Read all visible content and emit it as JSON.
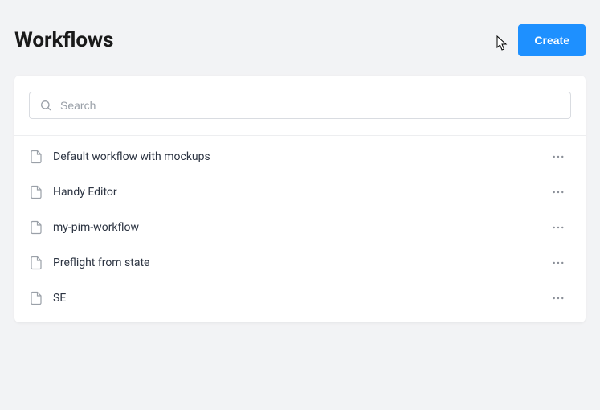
{
  "header": {
    "title": "Workflows",
    "create_label": "Create"
  },
  "search": {
    "placeholder": "Search"
  },
  "workflows": [
    {
      "name": "Default workflow with mockups"
    },
    {
      "name": "Handy Editor"
    },
    {
      "name": "my-pim-workflow"
    },
    {
      "name": "Preflight from state"
    },
    {
      "name": "SE"
    }
  ]
}
